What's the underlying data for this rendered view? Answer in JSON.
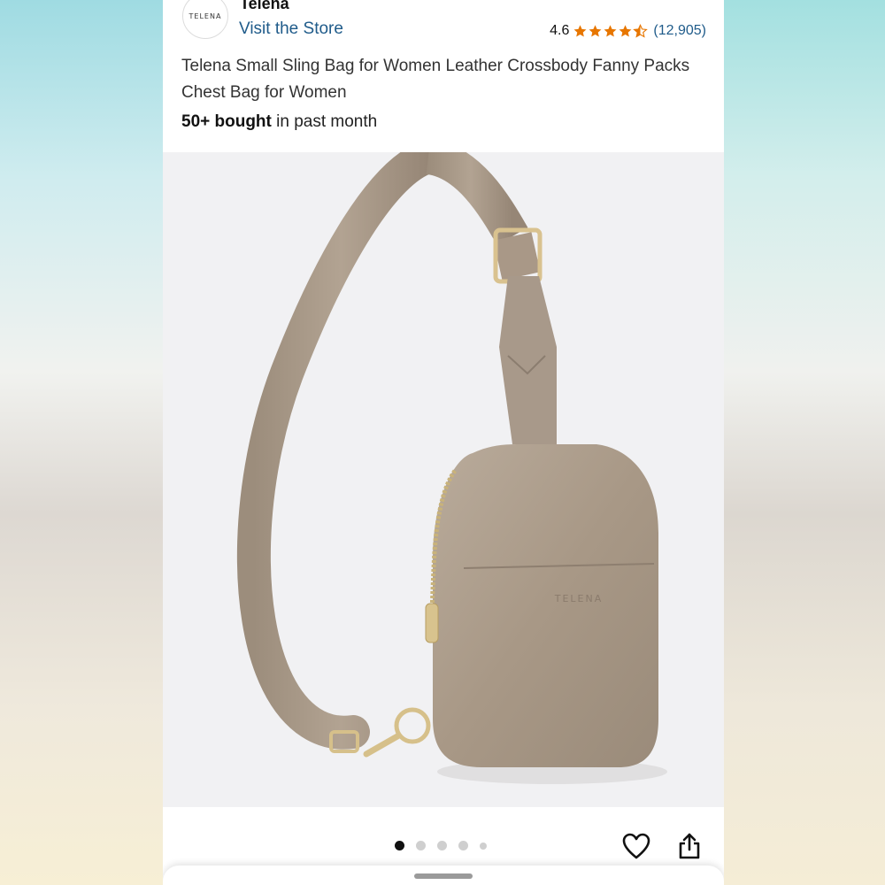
{
  "store": {
    "brand_name": "Telena",
    "logo_text": "TELENA",
    "visit_label": "Visit the Store"
  },
  "rating": {
    "value": "4.6",
    "stars": 4.5,
    "count": "(12,905)",
    "star_color": "#e77600"
  },
  "product": {
    "title": "Telena Small Sling Bag for Women Leather Crossbody Fanny Packs Chest Bag for Women",
    "bought_bold": "50+ bought",
    "bought_rest": " in past month",
    "image_brand_text": "TELENA"
  },
  "carousel": {
    "total": 5,
    "active_index": 0
  },
  "icons": {
    "favorite": "heart-icon",
    "share": "share-icon"
  },
  "colors": {
    "link": "#1f5b8a",
    "bag": "#a99a8a"
  }
}
